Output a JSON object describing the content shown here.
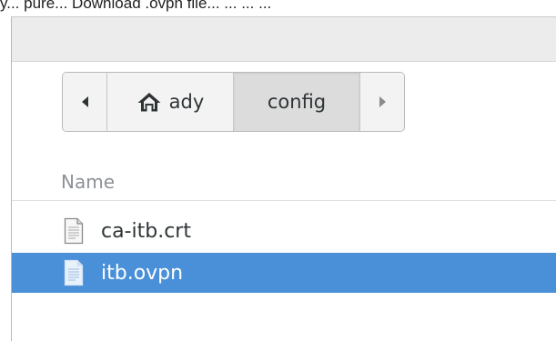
{
  "header_text": "y... pure... Download .ovpn file... ... ... ...",
  "pathbar": {
    "back_icon": "go-back-icon",
    "home_label": "ady",
    "home_icon": "home-icon",
    "current_label": "config",
    "forward_icon": "go-forward-icon"
  },
  "list": {
    "column_header": "Name",
    "files": [
      {
        "name": "ca-itb.crt",
        "icon": "text-file-icon",
        "selected": false
      },
      {
        "name": "itb.ovpn",
        "icon": "text-file-icon",
        "selected": true
      }
    ]
  },
  "colors": {
    "selection": "#4a90d9",
    "text": "#2e3436",
    "header_text": "#8d9196"
  }
}
